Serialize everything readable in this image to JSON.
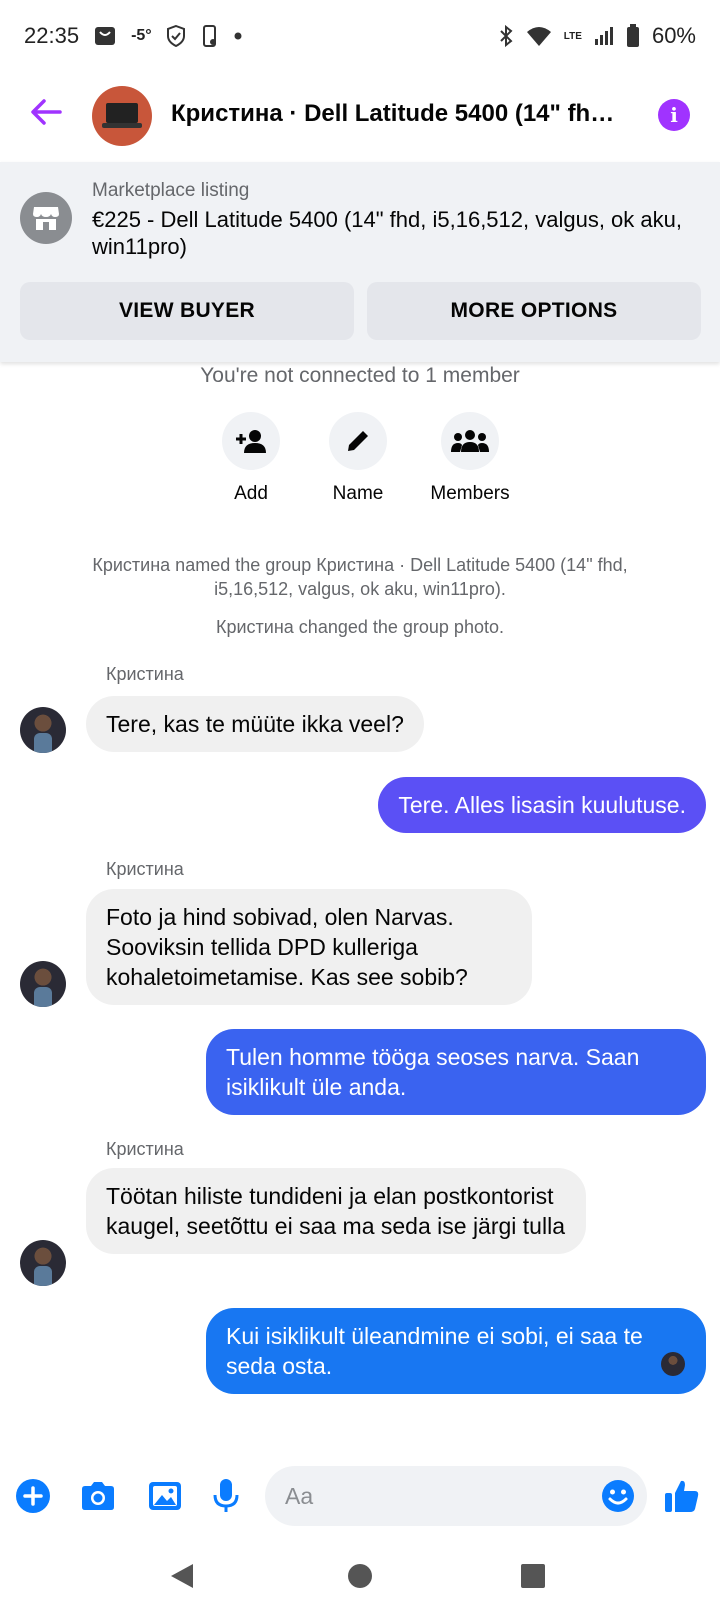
{
  "status_bar": {
    "time": "22:35",
    "temperature": "-5°",
    "battery": "60%",
    "network": "LTE"
  },
  "header": {
    "title": "Кристина · Dell Latitude 5400 (14\" fhd, i5,16,512, valgus, ok aku, win11pro)",
    "accent_color": "#a033ff"
  },
  "marketplace": {
    "label": "Marketplace listing",
    "title": "€225 - Dell Latitude 5400 (14\" fhd, i5,16,512, valgus, ok aku, win11pro)",
    "view_buyer": "VIEW BUYER",
    "more_options": "MORE OPTIONS"
  },
  "group_info": {
    "not_connected": "You're not connected to 1 member",
    "actions": [
      {
        "label": "Add",
        "icon": "add-person-icon"
      },
      {
        "label": "Name",
        "icon": "pencil-icon"
      },
      {
        "label": "Members",
        "icon": "group-icon"
      }
    ],
    "system_messages": [
      "Кристина named the group Кристина · Dell Latitude 5400 (14\" fhd, i5,16,512, valgus, ok aku, win11pro).",
      "Кристина changed the group photo."
    ]
  },
  "messages": [
    {
      "sender": "Кристина",
      "direction": "in",
      "text": "Tere, kas te müüte ikka veel?"
    },
    {
      "direction": "out",
      "text": "Tere. Alles lisasin kuulutuse.",
      "color": "#5b50f5"
    },
    {
      "sender": "Кристина",
      "direction": "in",
      "text": "Foto ja hind sobivad, olen Narvas. Sooviksin tellida DPD kulleriga kohaletoimetamise. Kas see sobib?"
    },
    {
      "direction": "out",
      "text": "Tulen homme tööga seoses narva. Saan isiklikult üle anda.",
      "color": "#3a63f0"
    },
    {
      "sender": "Кристина",
      "direction": "in",
      "text": "Töötan hiliste tundideni ja elan postkontorist kaugel, seetõttu ei saa ma seda ise järgi tulla"
    },
    {
      "direction": "out",
      "text": "Kui isiklikult üleandmine ei sobi, ei saa te seda osta.",
      "color": "#1877f2"
    }
  ],
  "composer": {
    "placeholder": "Aa",
    "accent_color": "#0a7cff"
  }
}
